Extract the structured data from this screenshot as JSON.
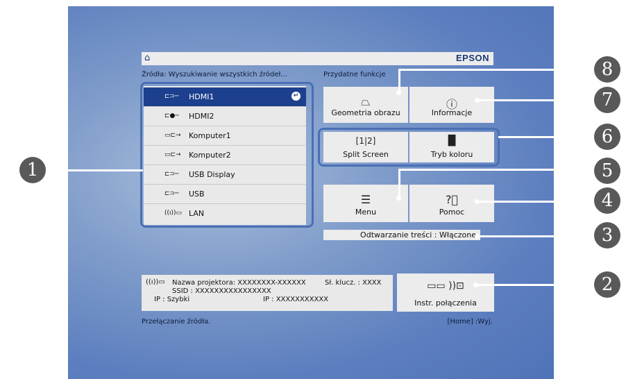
{
  "brand": "EPSON",
  "icons": {
    "home": "home-icon"
  },
  "sources_title": "Źródła: Wyszukiwanie wszystkich źródeł...",
  "functions_title": "Przydatne funkcje",
  "sources": [
    {
      "label": "HDMI1",
      "icon": "⊏⊃─",
      "selected": true
    },
    {
      "label": "HDMI2",
      "icon": "⊏●─",
      "selected": false
    },
    {
      "label": "Komputer1",
      "icon": "▭⊏→",
      "selected": false
    },
    {
      "label": "Komputer2",
      "icon": "▭⊏→",
      "selected": false
    },
    {
      "label": "USB Display",
      "icon": "⊏⊃─",
      "selected": false
    },
    {
      "label": "USB",
      "icon": "⊏⊃─",
      "selected": false
    },
    {
      "label": "LAN",
      "icon": "((ı))▭",
      "selected": false
    }
  ],
  "tiles": {
    "geometry": "Geometria obrazu",
    "info": "Informacje",
    "split": "Split Screen",
    "color": "Tryb koloru",
    "menu": "Menu",
    "help": "Pomoc",
    "connect": "Instr. połączenia"
  },
  "content_playback": "Odtwarzanie treści : Włączone",
  "network": {
    "projector_name": "Nazwa projektora: XXXXXXXX-XXXXXX",
    "key": "Sł. klucz. : XXXX",
    "ssid": "SSID : XXXXXXXXXXXXXXXX",
    "mode": "IP : Szybki",
    "ip": "IP : XXXXXXXXXXX"
  },
  "footer_left": "Przełączanie źródła.",
  "footer_right": "[Home] :Wyj.",
  "callouts": [
    "1",
    "2",
    "3",
    "4",
    "5",
    "6",
    "7",
    "8"
  ]
}
